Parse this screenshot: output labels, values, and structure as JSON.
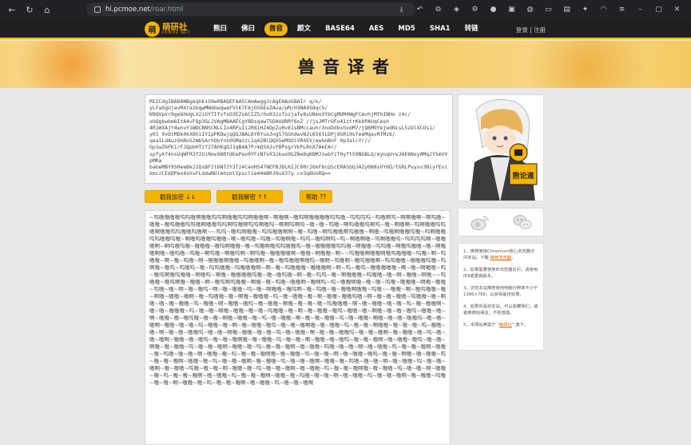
{
  "browser": {
    "url_host": "hi.pcmoe.net",
    "url_path": "/roar.html"
  },
  "site": {
    "logo_title": "萌研社",
    "logo_sub": "PCMOE.NET",
    "nav": [
      {
        "label": "熊曰",
        "active": false
      },
      {
        "label": "佛曰",
        "active": false
      },
      {
        "label": "兽音",
        "active": true
      },
      {
        "label": "颜文",
        "active": false
      },
      {
        "label": "BASE64",
        "active": false
      },
      {
        "label": "AES",
        "active": false
      },
      {
        "label": "MD5",
        "active": false
      },
      {
        "label": "SHA1",
        "active": false
      },
      {
        "label": "转链",
        "active": false
      }
    ],
    "login": "登录",
    "register": "注册",
    "login_sep": " | "
  },
  "banner": {
    "title": "兽音译者"
  },
  "input": {
    "text": "MIICdgIBADANBgkqhkiG9w0BAQEFAASCAmAwggJcAgEAAoGBAIr q/k/\nyLFaOgUjavMXra2bqwMWdGwqwaFVlK7FAjG56ExZAua/pM/H3NA958qc5/\nN9QVpxr9geQhUgLX2iGYTIfvfxO3EZs6CIZ5/hu932xTozjaTy8vU8mnXYbCgMUM4WgFCmvhjMfhINHo z4c/\nxUQgkwbm6ItA4vFQp3GLJVAgMBAAECgYBDsqawT5DAUORRf6oZ //jsJMTrOFu41ztrKkbPAUqCesh\n4R1WXAjY4wnvY1WDCBNSCNLLIo4RPuIi2R81HZ4OpZuHv81sNMccauhr3noDdbxhxbM7/jQ6M9YejwdNisL5zOlXCOs1/\ny01 9vDiMDk0kX8hiIYIpPKDwjqQQJBAL6Y0fuoJng57GGhdwvN2c656tLDPj9GRi0sfeeMqavRTMz6/\nqea1LdAuzOhRoS2WbSArhOkYns0GMazzc1q42BCQQX5eM9OiVR4EV/ewGnBnF 0p3alcYr//\nGp1wZ6FK1rFJQpbHTzf27AhKgOJ1qB4A7P/mQS6JvYDPsgrVkPLRnX7AkEAr/\nxpfyXf4nsUqWFR3f2UiRmx98RfdEePeo9YFzNTvX3zkuo9GZ8e8qKNMJiwbYzT0yft59NGBLQ/eynqUrwJAE6Nxy0MqJY5mVVpMRa\nbabeMBY9SHeeBk22QsBFIt6NT2Y3Tz4CeoH547NEFBJDLKIJC00rJ6kF6cQScERASbQJAZy088sVY6D/tGRLPuysv3NiyfEvikmczCEkDPex4shvFLddwNUlmhzml5psclie44mB0J0uX37y co3q6UoRQ=="
  },
  "buttons": {
    "encode": "戳我加密 ↓↓",
    "decode": "戳我解密 ↑↑",
    "help": "帮助 ??"
  },
  "output": {
    "text": "~呜嗷嗷嗷嗷呜呜嗷啊嗷嗷呜呜啊嗷嗷呜呜啊嗷嗷啊~啊嗷啊~嗷呜啊嗷嗷嗷嗷呜呜嗷~呜呜呜呜~呜嗷啊呜~啊啊嗷啊~啊呜嗷~嗷嗷~嗷呜嗷嗷呜呜嗷啊嗷嗷呜呜啊呜嗷啊呜呜啊嗷呜~啊啊呜啊呜~嗷~嗷~呜嗷~啊呜嗷嗷呜啊呜~嗷~啊嗷啊~呜啊嗷嗷呜呜嗷啊嗷嗷呜呜嗷嗷呜嗷啊~~呜呜~嗷呜啊嗷嗷~呜呜嗷嗷啊啊~嗷~呜嗷~啊呜嗷嗷啊呜嗷嗷~啊嗷~呜嗷啊嗷嗷呜嗷~呜啊嗷嗷呜呜嗷嗷呜嗷~啊嗷呜嗷嗷呜嗷嗷~啊~嗷呜嗷~呜嗷~呜嗷啊嗷~呜呜~嗷呜啊呜~呜~啊嗷啊嗷~呜啊嗷嗷呜~呜呜呜呜啊~嗷嗷嗷啊~啊呜嗷呜嗷~嗷嗷嗷~嗷呜啊嗷嗷~嗷~呜嗷啊嗷呜呜嗷嗷呜~嗷~嗷嗷嗷嗷呜呜嗷~啊嗷嗷~呜呜嗷~啊嗷呜嗷嗷~嗷~啊嗷嗷啊嗷~嗷呜嗷~呜嗷~啊呜嗷~啊嗷呜啊~啊呜嗷~嗷嗷嗷嗷啊~嗷嗷~啊嗷嗷~啊~~呜嗷嗷啊嗷嗷啊嗷呜嗷嗷嗷~呜嗷~啊~呜嗷嗷~啊~嗷~呜嗷~啊~嗷嗷嗷啊嗷嗷~呜嗷嗷啊~嗷~嗷呜嗷嗷啊嗷呜~嗷啊~呜嗷啊~嗷呜嗷嗷啊~呜呜嗷嗷~嗷嗷嗷呜嗷~呜啊嗷~嗷呜~呜嗷呜~嗷~呜呜嗷嗷~呜嗷嗷嗷啊~啊~嗷~呜嗷嗷嗷~嗷嗷嗷啊~啊~呜~嗷呜~嗷嗷嗷嗷嗷~啊~嗷~啊嗷嗷~呜~嗷呜啊嗷呜嗷嗷~啊嗷呜~啊嗷~嗷嗷嗷嗷呜嗷~嗷~嗷呜嗷~啊~嗷~呜呜~嗷~啊嗷嗷嗷~呜嗷嗷~嗷~啊~嗷嗷~啊嗷~~呜嗷嗷~嗷呜啊嗷~嗷嗷~啊~嗷呜啊呜嗷嗷~啊嗷~嗷~呜嗷~嗷嗷啊~嗷啊呜~呜~嗷嗷啊嗷~嗷~嗷~呜嗷~嗷嗷嗷~啊嗷~嗷嗷~呜嗷~嗷~啊~嗷~嗷呜~啊~嗷~嗷嗷~呜~嗷~啊嗷嗷~嗷呜啊~嗷~呜嗷~嗷~嗷嗷啊嗷嗷~呜嗷~~嗷嗷~啊~嗷呜嗷嗷~嗷~啊嗷~嗷嗷~嗷啊~嗷~呜嗷嗷~嗷~啊嗷~嗷嗷嗷~呜~嗷~嗷嗷~嗷~啊~嗷嗷~嗷嗷呜嗷~啊~嗷~嗷~嗷嗷~呜嗷嗷~嗷~啊嗷~嗷~嗷~嗷嗷~呜~嗷嗷~啊~嗷嗷~嗷呜~嗷~嗷嗷~啊嗷~嗷~嗷~嗷~呜嗷嗷嗷~啊~嗷~嗷嗷~嗷~嗷~呜~嗷~嗷嗷啊~嗷~嗷~嗷嗷嗷~呜~嗷~嗷~啊嗷~嗷嗷~嗷~嗷~呜嗷嗷~嗷~啊~嗷~嗷嗷~嗷呜~嗷嗷~嗷~啊嗷~嗷~嗷~嗷呜~嗷嗷~嗷~啊~嗷嗷~嗷~嗷呜嗷~嗷~嗷~啊嗷~嗷嗷~嗷~呜~嗷~嗷嗷~啊~嗷~嗷~嗷嗷~呜~嗷~嗷嗷~啊嗷~嗷~嗷~嗷嗷呜~嗷~嗷~嗷啊~嗷嗷~嗷~嗷~呜~嗷嗷~嗷~啊~嗷~嗷嗷~嗷呜~嗷~嗷~嗷啊嗷~嗷~嗷嗷~呜~嗷~嗷~啊嗷嗷~嗷~嗷~嗷~呜~嗷嗷~嗷~啊~嗷~嗷~嗷嗷呜~嗷~嗷~啊嗷~嗷嗷~嗷~嗷~呜~嗷~嗷嗷~啊~嗷~嗷~嗷嗷呜~嗷~嗷~嗷啊~嗷~嗷嗷~嗷~呜~嗷~嗷~嗷啊~嗷嗷~嗷~嗷呜~嗷~嗷~嗷啊嗷~嗷~嗷嗷~呜~嗷~嗷~啊~嗷嗷~嗷~嗷呜~嗷~嗷~嗷啊~嗷~嗷嗷~嗷呜~嗷~嗷~啊嗷~嗷~嗷嗷~呜~嗷~嗷~嗷啊~嗷嗷~嗷~呜~嗷~嗷~嗷啊~嗷~嗷嗷~呜嗷~嗷~嗷~啊~嗷~嗷嗷~呜~嗷~嗷~嗷啊~嗷嗷~嗷~呜嗷~嗷~嗷~啊~嗷嗷~嗷~呜~嗷~嗷~嗷啊嗷~嗷~嗷嗷~呜~嗷~嗷~啊~嗷~嗷嗷~嗷呜~嗷~嗷~啊嗷~嗷~嗷嗷~呜~嗷~嗷~嗷啊~嗷嗷~嗷~呜~嗷~嗷~嗷啊~嗷~嗷嗷~呜~嗷~嗷~嗷啊~嗷嗷~嗷~呜嗷~嗷~嗷~啊~嗷~嗷嗷~呜~嗷~嗷~嗷啊~嗷~嗷嗷~呜嗷~嗷~嗷~啊~嗷嗷~嗷~呜~嗷~嗷~嗷啊~嗷~嗷嗷~呜~嗷~嗷~嗷啊嗷~嗷~嗷嗷~呜~嗷~嗷~啊~嗷嗷~嗷~呜~嗷~嗷~嗷啊~嗷~嗷嗷~呜~嗷~嗷~嗷啊~嗷嗷~嗷~呜嗷~嗷~嗷~啊~嗷~嗷嗷~呜~嗷~嗷~嗷啊~嗷~嗷嗷~呜嗷~嗷~嗷~啊~嗷嗷~嗷~呜~嗷~嗷~嗷啊~嗷~嗷嗷~呜~嗷~嗷~嗷啊"
  },
  "sidebar": {
    "notes": [
      {
        "pre": "1、推荐使用Chromium核心浏览器访问本站。下载 ",
        "link": "推荐浏览器",
        "post": "。"
      },
      {
        "pre": "2、如果需要使用IE浏览器访问，请使用IE9或更高版本。",
        "link": "",
        "post": ""
      },
      {
        "pre": "3、浏览本站推荐使用电脑分辨率不小于1366×768，以获得最佳效果。",
        "link": "",
        "post": ""
      },
      {
        "pre": "4、如果你喜欢本站，可以收藏我们，或者推荐给朋友，不胜感激。",
        "link": "",
        "post": ""
      },
      {
        "pre": "5、本网站隶属于 “",
        "link": "萌研社",
        "post": "” 旗下。"
      }
    ],
    "badge": "熊论道"
  },
  "colors": {
    "accent": "#f5b400",
    "nav_bg": "#1f1f1f"
  }
}
